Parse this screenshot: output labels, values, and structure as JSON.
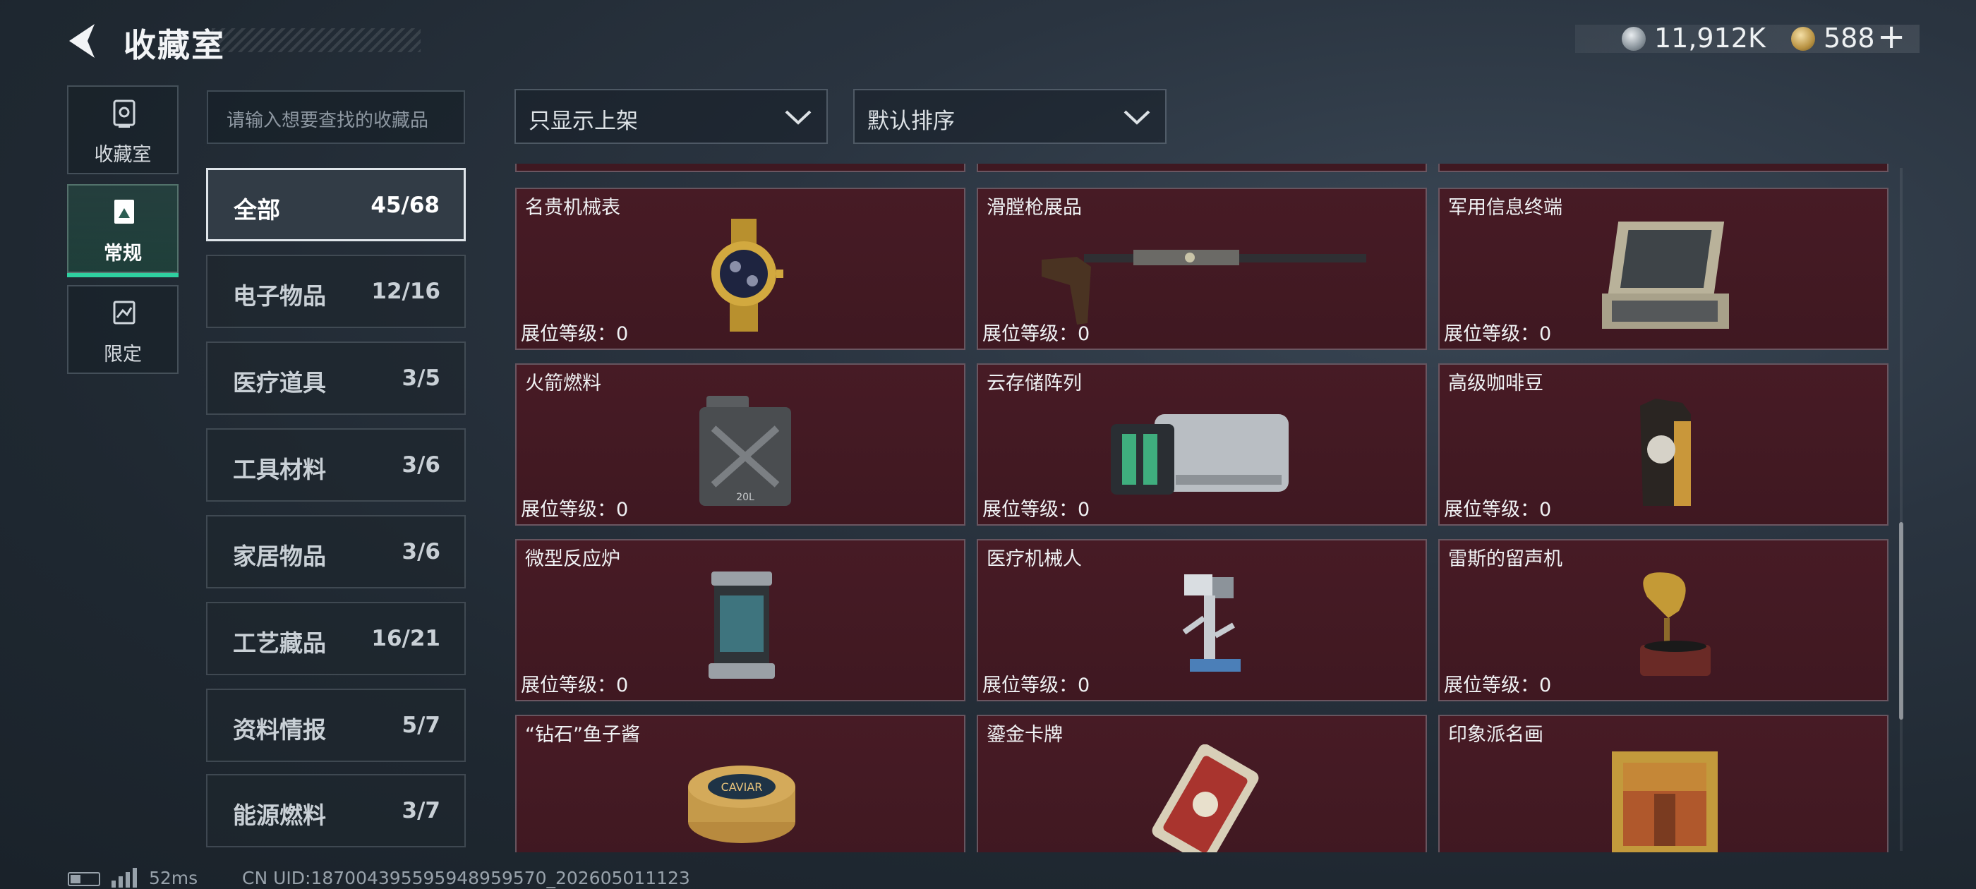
{
  "header": {
    "title": "收藏室",
    "silver": "11,912K",
    "gold": "588",
    "add": "+"
  },
  "side_tabs": [
    {
      "label": "收藏室",
      "icon": "vault-icon"
    },
    {
      "label": "常规",
      "icon": "exhibit-icon"
    },
    {
      "label": "限定",
      "icon": "limited-icon"
    }
  ],
  "search": {
    "placeholder": "请输入想要查找的收藏品"
  },
  "filters": {
    "shelf": "只显示上架",
    "sort": "默认排序"
  },
  "categories": [
    {
      "label": "全部",
      "count": "45/68"
    },
    {
      "label": "电子物品",
      "count": "12/16"
    },
    {
      "label": "医疗道具",
      "count": "3/5"
    },
    {
      "label": "工具材料",
      "count": "3/6"
    },
    {
      "label": "家居物品",
      "count": "3/6"
    },
    {
      "label": "工艺藏品",
      "count": "16/21"
    },
    {
      "label": "资料情报",
      "count": "5/7"
    },
    {
      "label": "能源燃料",
      "count": "3/7"
    }
  ],
  "items": [
    {
      "name": "名贵机械表",
      "level": "展位等级：0",
      "icon": "watch-icon"
    },
    {
      "name": "滑膛枪展品",
      "level": "展位等级：0",
      "icon": "musket-icon"
    },
    {
      "name": "军用信息终端",
      "level": "展位等级：0",
      "icon": "terminal-icon"
    },
    {
      "name": "火箭燃料",
      "level": "展位等级：0",
      "icon": "fuel-can-icon"
    },
    {
      "name": "云存储阵列",
      "level": "展位等级：0",
      "icon": "storage-array-icon"
    },
    {
      "name": "高级咖啡豆",
      "level": "展位等级：0",
      "icon": "coffee-bag-icon"
    },
    {
      "name": "微型反应炉",
      "level": "展位等级：0",
      "icon": "reactor-icon"
    },
    {
      "name": "医疗机械人",
      "level": "展位等级：0",
      "icon": "medical-robot-icon"
    },
    {
      "name": "雷斯的留声机",
      "level": "展位等级：0",
      "icon": "gramophone-icon"
    },
    {
      "name": "“钻石”鱼子酱",
      "level": "",
      "icon": "caviar-tin-icon"
    },
    {
      "name": "鎏金卡牌",
      "level": "",
      "icon": "gold-card-icon"
    },
    {
      "name": "印象派名画",
      "level": "",
      "icon": "painting-icon"
    }
  ],
  "caviar_label": "CAVIAR",
  "fuel_label": "20L",
  "status": {
    "ping": "52ms",
    "uid": "CN UID:1870043955959489595​70_202605011123"
  }
}
